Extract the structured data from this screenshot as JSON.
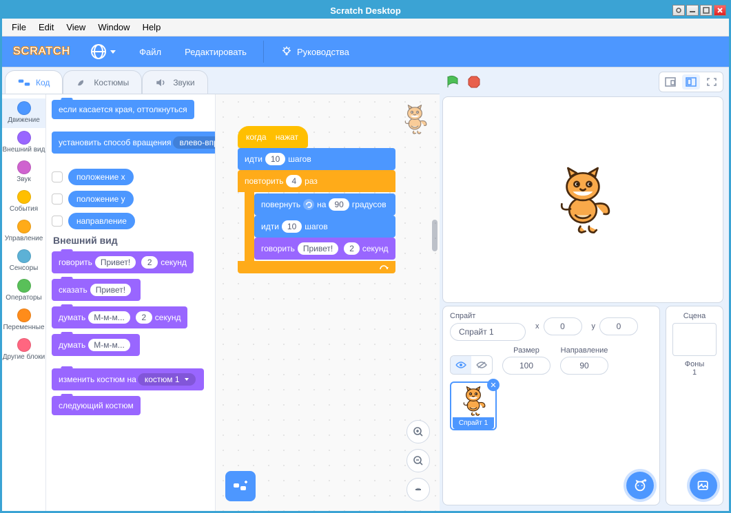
{
  "window": {
    "title": "Scratch Desktop"
  },
  "menubar": [
    "File",
    "Edit",
    "View",
    "Window",
    "Help"
  ],
  "header": {
    "logo": "SCRATCH",
    "file": "Файл",
    "edit": "Редактировать",
    "tutorials": "Руководства"
  },
  "tabs": {
    "code": "Код",
    "costumes": "Костюмы",
    "sounds": "Звуки"
  },
  "categories": [
    {
      "id": "motion",
      "label": "Движение",
      "color": "#4c97ff"
    },
    {
      "id": "looks",
      "label": "Внешний вид",
      "color": "#9966ff"
    },
    {
      "id": "sound",
      "label": "Звук",
      "color": "#cf63cf"
    },
    {
      "id": "events",
      "label": "События",
      "color": "#ffbf00"
    },
    {
      "id": "control",
      "label": "Управление",
      "color": "#ffab19"
    },
    {
      "id": "sensing",
      "label": "Сенсоры",
      "color": "#5cb1d6"
    },
    {
      "id": "operators",
      "label": "Операторы",
      "color": "#59c059"
    },
    {
      "id": "variables",
      "label": "Переменные",
      "color": "#ff8c1a"
    },
    {
      "id": "myblocks",
      "label": "Другие блоки",
      "color": "#ff6680"
    }
  ],
  "palette": {
    "motion": {
      "edge_bounce": "если касается края, оттолкнуться",
      "set_rotation_label": "установить способ вращения",
      "set_rotation_value": "влево-вправо",
      "x_position": "положение x",
      "y_position": "положение y",
      "direction": "направление"
    },
    "looks_header": "Внешний вид",
    "looks": {
      "say_for_label": "говорить",
      "say_for_text": "Привет!",
      "say_for_secs": "2",
      "say_for_suffix": "секунд",
      "say_label": "сказать",
      "say_text": "Привет!",
      "think_for_label": "думать",
      "think_for_text": "М-м-м...",
      "think_for_secs": "2",
      "think_for_suffix": "секунд",
      "think_label": "думать",
      "think_text": "М-м-м...",
      "switch_costume_label": "изменить костюм на",
      "switch_costume_value": "костюм 1",
      "next_costume": "следующий костюм"
    }
  },
  "script": {
    "hat_pre": "когда",
    "hat_post": "нажат",
    "move1_pre": "идти",
    "move1_val": "10",
    "move1_post": "шагов",
    "repeat_pre": "повторить",
    "repeat_val": "4",
    "repeat_post": "раз",
    "turn_pre": "повернуть",
    "turn_mid": "на",
    "turn_val": "90",
    "turn_post": "градусов",
    "move2_pre": "идти",
    "move2_val": "10",
    "move2_post": "шагов",
    "say_pre": "говорить",
    "say_text": "Привет!",
    "say_secs": "2",
    "say_post": "секунд"
  },
  "sprite_info": {
    "label_sprite": "Спрайт",
    "name": "Спрайт 1",
    "label_x": "x",
    "x": "0",
    "label_y": "y",
    "y": "0",
    "label_size": "Размер",
    "size": "100",
    "label_direction": "Направление",
    "direction": "90"
  },
  "sprite_tile": {
    "name": "Спрайт 1"
  },
  "stage_panel": {
    "title": "Сцена",
    "backdrops_label": "Фоны",
    "backdrops_count": "1"
  }
}
